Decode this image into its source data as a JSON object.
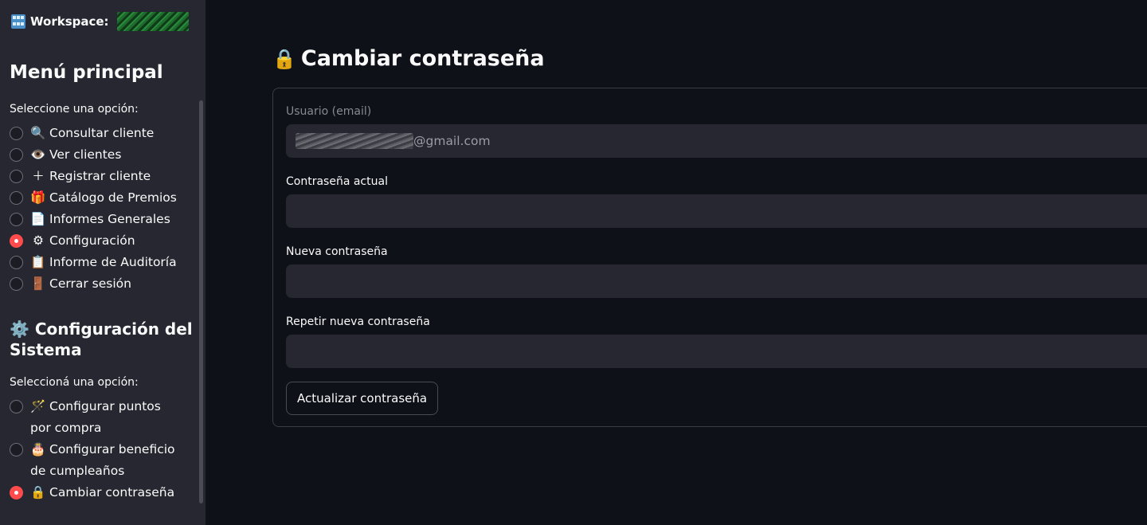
{
  "sidebar": {
    "workspace_label": "Workspace:",
    "main_menu_title": "Menú principal",
    "main_menu_caption": "Seleccione una opción:",
    "main_menu_items": [
      {
        "icon": "magnifier-icon",
        "emoji": "🔍",
        "label": "Consultar cliente",
        "selected": false
      },
      {
        "icon": "eye-icon",
        "emoji": "👁️",
        "label": "Ver clientes",
        "selected": false
      },
      {
        "icon": "plus-icon",
        "emoji": "＋",
        "label": "Registrar cliente",
        "selected": false
      },
      {
        "icon": "gift-icon",
        "emoji": "🎁",
        "label": "Catálogo de Premios",
        "selected": false
      },
      {
        "icon": "document-icon",
        "emoji": "📄",
        "label": "Informes Generales",
        "selected": false
      },
      {
        "icon": "gear-icon",
        "emoji": "⚙",
        "label": "Configuración",
        "selected": true
      },
      {
        "icon": "clipboard-icon",
        "emoji": "📋",
        "label": "Informe de Auditoría",
        "selected": false
      },
      {
        "icon": "door-icon",
        "emoji": "🚪",
        "label": "Cerrar sesión",
        "selected": false
      }
    ],
    "config_title": "⚙️ Configuración del Sistema",
    "config_caption": "Seleccioná una opción:",
    "config_items": [
      {
        "icon": "wand-icon",
        "emoji": "🪄",
        "label": "Configurar puntos por compra",
        "selected": false
      },
      {
        "icon": "cake-icon",
        "emoji": "🎂",
        "label": "Configurar beneficio de cumpleaños",
        "selected": false
      },
      {
        "icon": "lock-icon",
        "emoji": "🔒",
        "label": "Cambiar contraseña",
        "selected": true
      }
    ]
  },
  "main": {
    "title": "Cambiar contraseña",
    "title_icon": "lock-icon",
    "user_label": "Usuario (email)",
    "user_value_suffix": "@gmail.com",
    "current_password_label": "Contraseña actual",
    "new_password_label": "Nueva contraseña",
    "repeat_password_label": "Repetir nueva contraseña",
    "submit_label": "Actualizar contraseña"
  },
  "colors": {
    "background": "#0e1117",
    "sidebar": "#262730",
    "accent": "#ff4b4b"
  }
}
